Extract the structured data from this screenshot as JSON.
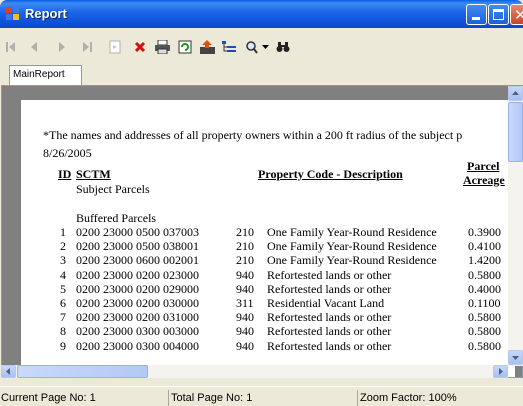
{
  "window": {
    "title": "Report"
  },
  "toolbar": {
    "buttons": [
      "first-page",
      "previous-page",
      "next-page",
      "last-page",
      "goto-page",
      "close",
      "print",
      "refresh",
      "export",
      "toggle-tree",
      "zoom",
      "find"
    ]
  },
  "tabs": [
    {
      "label": "MainReport"
    }
  ],
  "report": {
    "intro": "*The names and addresses of all property owners within a 200 ft radius of the subject p",
    "date": "8/26/2005",
    "headers": {
      "id": "ID",
      "sctm": "SCTM",
      "property": "Property Code - Description",
      "parcel": "Parcel",
      "acreage": "Acreage"
    },
    "subject_label": "Subject Parcels",
    "buffered_label": "Buffered Parcels",
    "rows": [
      {
        "id": "1",
        "sctm": "0200 23000 0500 037003",
        "code": "210",
        "desc": "One Family Year-Round Residence",
        "acreage": "0.3900"
      },
      {
        "id": "2",
        "sctm": "0200 23000 0500 038001",
        "code": "210",
        "desc": "One Family Year-Round Residence",
        "acreage": "0.4100"
      },
      {
        "id": "3",
        "sctm": "0200 23000 0600 002001",
        "code": "210",
        "desc": "One Family Year-Round Residence",
        "acreage": "1.4200"
      },
      {
        "id": "4",
        "sctm": "0200 23000 0200 023000",
        "code": "940",
        "desc": "Refortested lands or other",
        "acreage": "0.5800"
      },
      {
        "id": "5",
        "sctm": "0200 23000 0200 029000",
        "code": "940",
        "desc": "Refortested lands or other",
        "acreage": "0.4000"
      },
      {
        "id": "6",
        "sctm": "0200 23000 0200 030000",
        "code": "311",
        "desc": "Residential Vacant Land",
        "acreage": "0.1100"
      },
      {
        "id": "7",
        "sctm": "0200 23000 0200 031000",
        "code": "940",
        "desc": "Refortested lands or other",
        "acreage": "0.5800"
      },
      {
        "id": "8",
        "sctm": "0200 23000 0300 003000",
        "code": "940",
        "desc": "Refortested lands or other",
        "acreage": "0.5800"
      },
      {
        "id": "9",
        "sctm": "0200 23000 0300 004000",
        "code": "940",
        "desc": "Refortested lands or other",
        "acreage": "0.5800"
      }
    ]
  },
  "status": {
    "current_page": "Current Page No: 1",
    "total_page": "Total Page No: 1",
    "zoom": "Zoom Factor: 100%"
  },
  "colors": {
    "titlebar": "#0a5ee6",
    "viewport_bg": "#808080",
    "chrome": "#ece9d8",
    "close_red": "#c00000"
  }
}
